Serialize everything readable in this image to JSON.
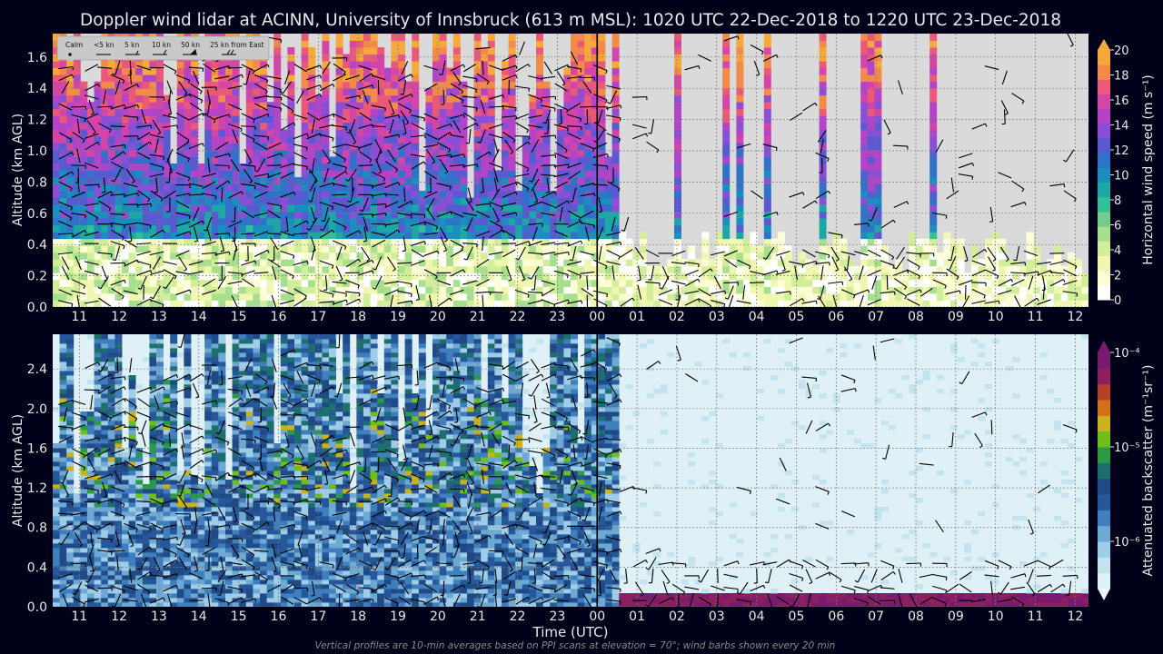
{
  "title": "Doppler wind lidar at ACINN, University of Innsbruck (613 m MSL): 1020 UTC 22-Dec-2018 to 1220 UTC 23-Dec-2018",
  "footnote": "Vertical profiles are 10-min averages based on PPI scans at elevation = 70°; wind barbs shown every 20 min",
  "xlabel": "Time (UTC)",
  "barb_legend": [
    "Calm",
    "<5 kn",
    "5 kn",
    "10 kn",
    "50 kn",
    "25 kn from East"
  ],
  "colors": {
    "background": "#000018",
    "plot_bg_top": "#dadada",
    "plot_bg_bottom": "#dff1f7",
    "midnight_line": "#000000",
    "grid": "#7a7a7a"
  },
  "chart_data": [
    {
      "type": "heatmap",
      "name": "wind-speed-panel",
      "ylabel": "Altitude (km AGL)",
      "ylim": [
        0.0,
        1.75
      ],
      "yticks": [
        "0.0",
        "0.2",
        "0.4",
        "0.6",
        "0.8",
        "1.0",
        "1.2",
        "1.4",
        "1.6"
      ],
      "ytick_values": [
        0.0,
        0.2,
        0.4,
        0.6,
        0.8,
        1.0,
        1.2,
        1.4,
        1.6
      ],
      "xticks": [
        "11",
        "12",
        "13",
        "14",
        "15",
        "16",
        "17",
        "18",
        "19",
        "20",
        "21",
        "22",
        "23",
        "00",
        "01",
        "02",
        "03",
        "04",
        "05",
        "06",
        "07",
        "08",
        "09",
        "10",
        "11",
        "12"
      ],
      "xlim_hours": [
        10.333,
        36.333
      ],
      "midnight_hour": 24,
      "grid": true,
      "colorbar": {
        "label": "Horizontal wind speed (m s⁻¹)",
        "ticks": [
          "0",
          "2",
          "4",
          "6",
          "8",
          "10",
          "12",
          "14",
          "16",
          "18",
          "20"
        ],
        "range": [
          0,
          20
        ],
        "extend": "max"
      }
    },
    {
      "type": "heatmap",
      "name": "backscatter-panel",
      "ylabel": "Altitude (km AGL)",
      "ylim": [
        0.0,
        2.75
      ],
      "yticks": [
        "0.0",
        "0.4",
        "0.8",
        "1.2",
        "1.6",
        "2.0",
        "2.4"
      ],
      "ytick_values": [
        0.0,
        0.4,
        0.8,
        1.2,
        1.6,
        2.0,
        2.4
      ],
      "xticks": [
        "11",
        "12",
        "13",
        "14",
        "15",
        "16",
        "17",
        "18",
        "19",
        "20",
        "21",
        "22",
        "23",
        "00",
        "01",
        "02",
        "03",
        "04",
        "05",
        "06",
        "07",
        "08",
        "09",
        "10",
        "11",
        "12"
      ],
      "xlim_hours": [
        10.333,
        36.333
      ],
      "midnight_hour": 24,
      "grid": true,
      "colorbar": {
        "label": "Attenuated backscatter (m⁻¹sr⁻¹)",
        "tick_labels": [
          "10⁻⁴",
          "10⁻⁵",
          "10⁻⁶"
        ],
        "extend": "both",
        "scale": "log"
      }
    }
  ]
}
